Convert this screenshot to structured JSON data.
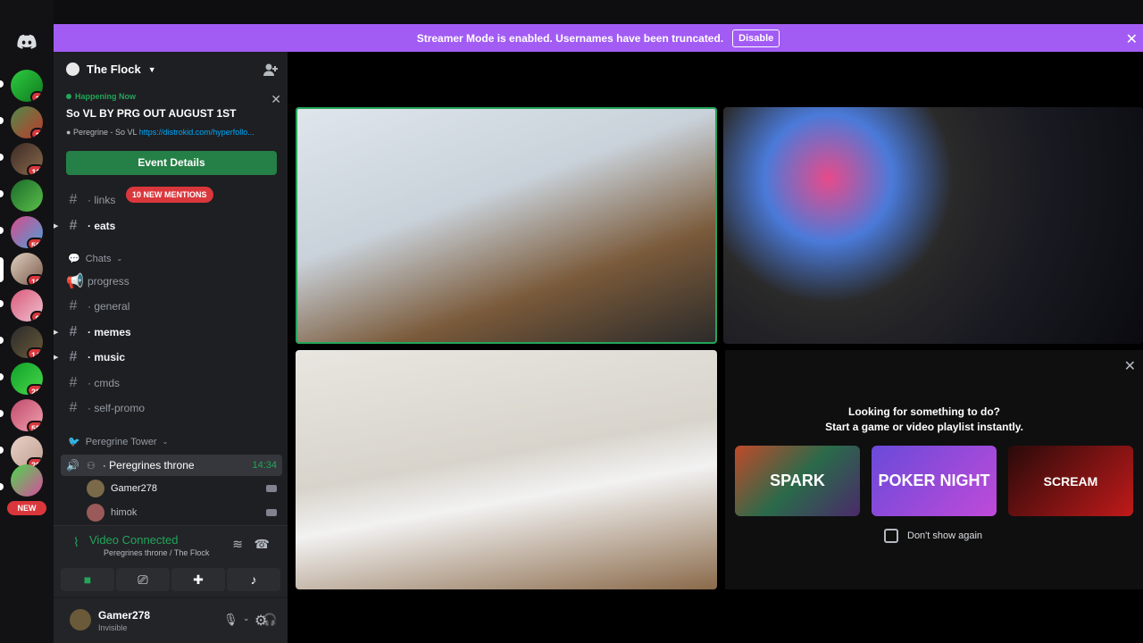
{
  "banner": {
    "message": "Streamer Mode is enabled. Usernames have been truncated.",
    "disable_label": "Disable"
  },
  "rail": {
    "servers": [
      {
        "badge": "1"
      },
      {
        "badge": "1"
      },
      {
        "badge": "11"
      },
      {
        "badge": ""
      },
      {
        "badge": "56"
      },
      {
        "badge": "10"
      },
      {
        "badge": "9"
      },
      {
        "badge": "14"
      },
      {
        "badge": "28"
      },
      {
        "badge": "55"
      },
      {
        "badge": "20"
      },
      {
        "badge": ""
      }
    ],
    "new_label": "NEW"
  },
  "server": {
    "name": "The Flock"
  },
  "event": {
    "status": "Happening Now",
    "title": "So VL BY PRG OUT AUGUST 1ST",
    "location_prefix": "Peregrine - So VL",
    "location_link": "https://distrokid.com/hyperfollo...",
    "button_label": "Event Details"
  },
  "channels": {
    "links": "· links",
    "mentions_label": "10 NEW MENTIONS",
    "eats": "· eats",
    "chats_category": "Chats",
    "progress": "progress",
    "general": "· general",
    "memes": "· memes",
    "music": "· music",
    "cmds": "· cmds",
    "self_promo": "· self-promo",
    "tower_category": "Peregrine Tower",
    "voice_channel": "· Peregrines throne",
    "voice_time": "14:34"
  },
  "members": [
    {
      "name": "Gamer278"
    },
    {
      "name": "himok"
    }
  ],
  "voice_panel": {
    "status": "Video Connected",
    "location": "Peregrines throne / The Flock"
  },
  "user": {
    "name": "Gamer278",
    "status": "Invisible"
  },
  "activity": {
    "line1": "Looking for something to do?",
    "line2": "Start a game or video playlist instantly.",
    "cards": [
      "SPARK",
      "POKER NIGHT",
      "SCREAM"
    ],
    "dont_show": "Don't show again"
  },
  "colors": {
    "accent_banner": "#a25cf4",
    "green": "#23a55a",
    "red_badge": "#da373c"
  }
}
